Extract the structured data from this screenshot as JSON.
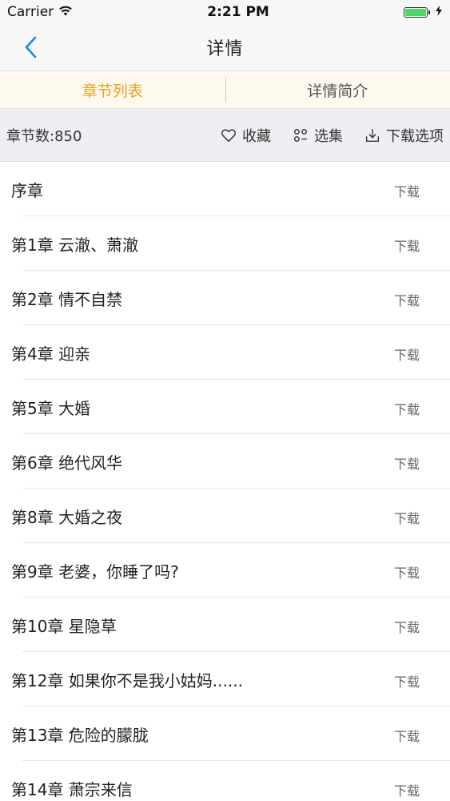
{
  "status_bar": {
    "carrier": "Carrier",
    "time": "2:21 PM",
    "battery_level": 1.0,
    "battery_color": "#4cd964"
  },
  "nav": {
    "title": "详情",
    "back_icon": "chevron-left-icon",
    "accent_color": "#1a82fb"
  },
  "tabs": [
    {
      "label": "章节列表",
      "active": true
    },
    {
      "label": "详情简介",
      "active": false
    }
  ],
  "tab_active_color": "#f0a020",
  "toolbar": {
    "chapter_count": "章节数:850",
    "favorite_label": "收藏",
    "favorite_icon": "heart-icon",
    "select_label": "选集",
    "select_icon": "grid-circles-icon",
    "download_options_label": "下载选项",
    "download_icon": "download-icon"
  },
  "chapters": [
    {
      "title": "序章",
      "action": "下载"
    },
    {
      "title": "第1章 云澈、萧澈",
      "action": "下载"
    },
    {
      "title": "第2章 情不自禁",
      "action": "下载"
    },
    {
      "title": "第4章 迎亲",
      "action": "下载"
    },
    {
      "title": "第5章 大婚",
      "action": "下载"
    },
    {
      "title": "第6章 绝代风华",
      "action": "下载"
    },
    {
      "title": "第8章 大婚之夜",
      "action": "下载"
    },
    {
      "title": "第9章 老婆，你睡了吗?",
      "action": "下载"
    },
    {
      "title": "第10章 星隐草",
      "action": "下载"
    },
    {
      "title": "第12章 如果你不是我小姑妈......",
      "action": "下载"
    },
    {
      "title": "第13章 危险的朦胧",
      "action": "下载"
    },
    {
      "title": "第14章 萧宗来信",
      "action": "下载"
    }
  ]
}
